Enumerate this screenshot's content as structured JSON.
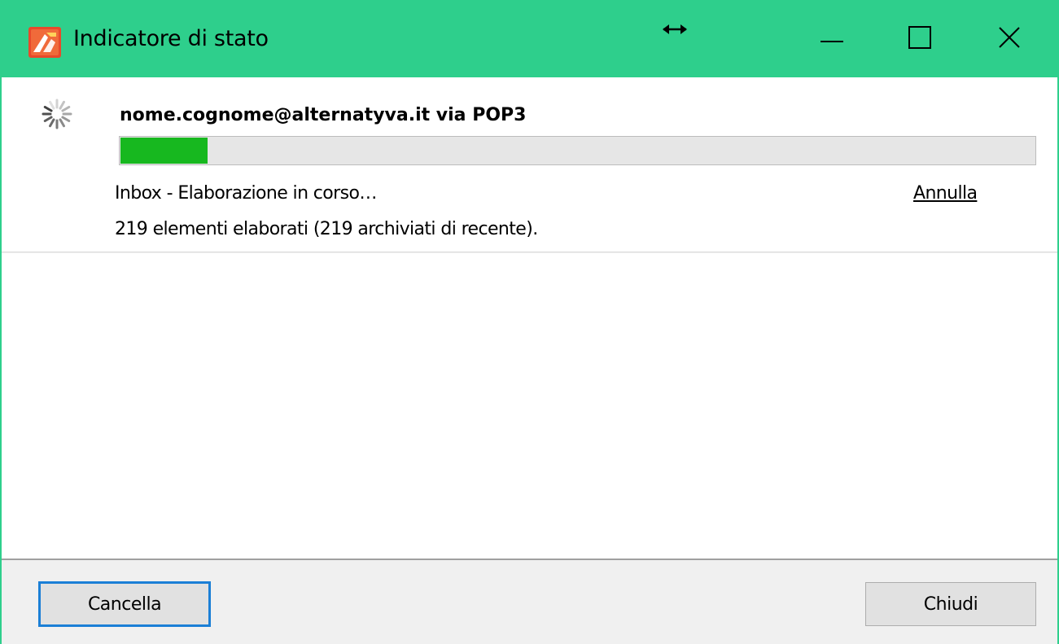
{
  "window": {
    "title": "Indicatore di stato",
    "accent_color": "#2ecf8c",
    "app_icon": "app-logo-icon",
    "caption_buttons": [
      "minimize-icon",
      "maximize-icon",
      "close-icon"
    ]
  },
  "status": {
    "account": "nome.cognome@alternatyva.it via POP3",
    "spinner_icon": "loading-spinner-icon",
    "progress_fraction": 0.095,
    "progress_color": "#17b81f",
    "task": "Inbox - Elaborazione in corso…",
    "cancel_link": "Annulla",
    "items": "219 elementi elaborati (219 archiviati di recente)."
  },
  "footer": {
    "cancella_label": "Cancella",
    "chiudi_label": "Chiudi"
  }
}
